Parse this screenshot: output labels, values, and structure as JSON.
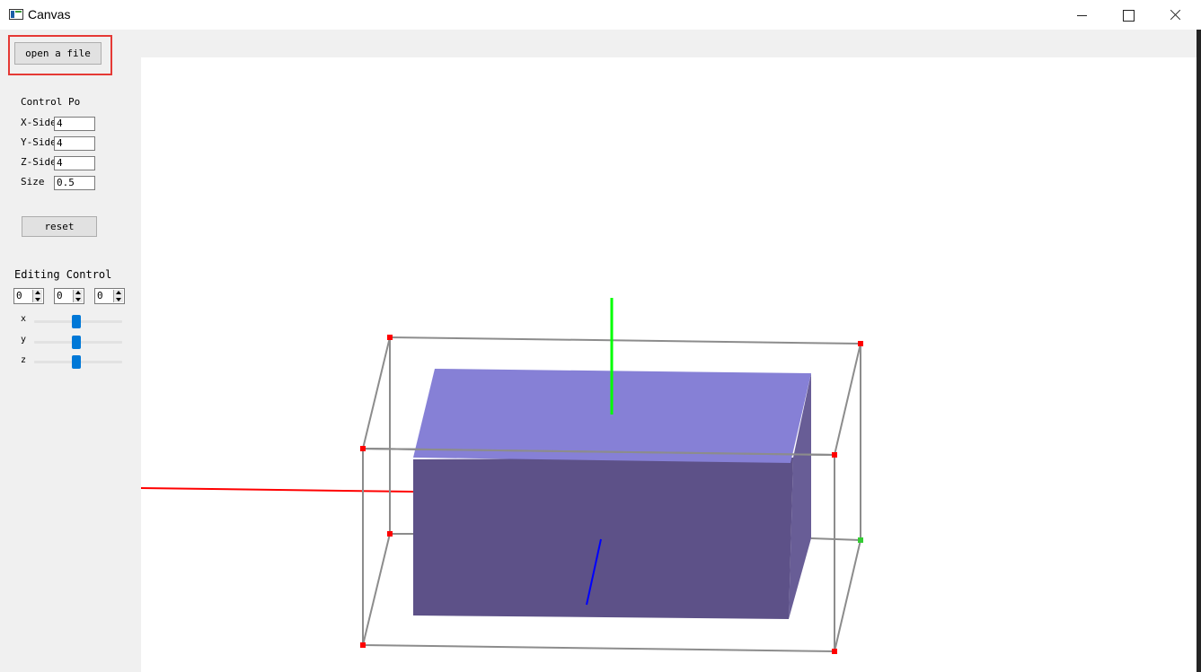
{
  "window": {
    "title": "Canvas",
    "minimize_icon": "minimize-icon",
    "maximize_icon": "maximize-icon",
    "close_icon": "close-icon"
  },
  "toolbar": {
    "open_file_label": "open a file"
  },
  "control_points": {
    "heading": "Control Po",
    "fields": [
      {
        "label": "X-Side",
        "value": "4"
      },
      {
        "label": "Y-Side",
        "value": "4"
      },
      {
        "label": "Z-Side",
        "value": "4"
      },
      {
        "label": "Size",
        "value": "0.5"
      }
    ],
    "reset_label": "reset"
  },
  "editing_control": {
    "heading": "Editing Control",
    "spinners": [
      "0",
      "0",
      "0"
    ],
    "sliders": [
      {
        "label": "x",
        "level": 0.5
      },
      {
        "label": "y",
        "level": 0.5
      },
      {
        "label": "z",
        "level": 0.5
      }
    ]
  },
  "colors": {
    "box_top": "#8680d6",
    "box_front": "#5d5188",
    "box_side": "#685d96",
    "x_axis": "#ff0000",
    "y_axis": "#00ff00",
    "z_axis": "#0000ff",
    "lattice": "#8c8c8c",
    "control_point": "#ff0000",
    "selected_point": "#33cc33",
    "highlight": "#e53935"
  }
}
